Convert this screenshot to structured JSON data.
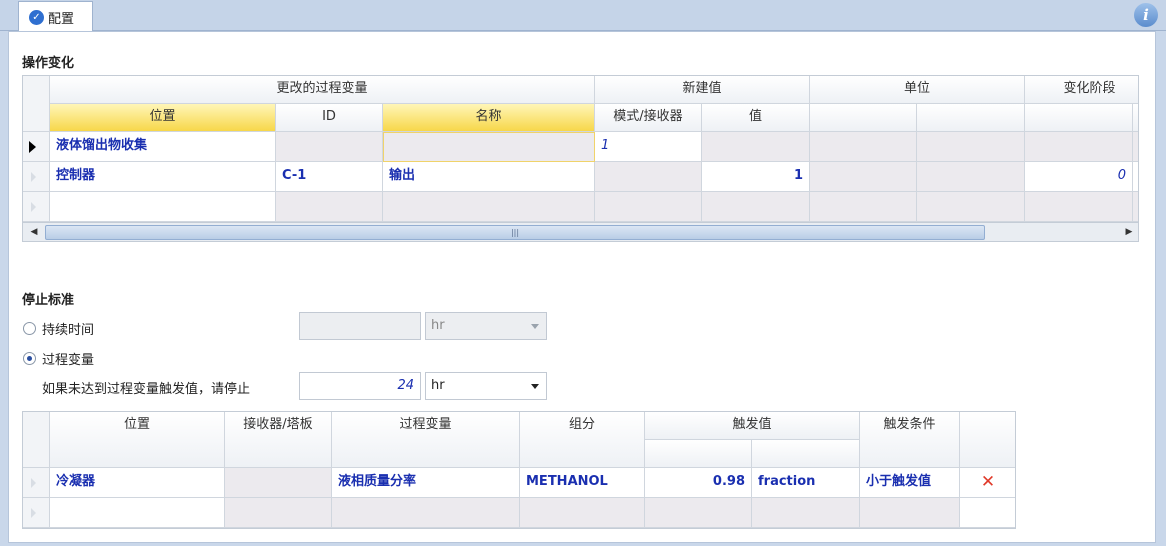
{
  "tab": {
    "label": "配置"
  },
  "sections": {
    "operation_change": "操作变化",
    "stop_criteria": "停止标准"
  },
  "grid1": {
    "group_headers": [
      "更改的过程变量",
      "新建值",
      "单位",
      "变化阶段"
    ],
    "sub_headers": [
      "位置",
      "ID",
      "名称",
      "模式/接收器",
      "值"
    ],
    "rows": [
      {
        "location": "液体馏出物收集",
        "id": "",
        "name": "",
        "mode": "1",
        "value": "",
        "stage": ""
      },
      {
        "location": "控制器",
        "id": "C-1",
        "name": "输出",
        "mode": "",
        "value": "1",
        "stage": "0"
      },
      {
        "location": "",
        "id": "",
        "name": "",
        "mode": "",
        "value": "",
        "stage": ""
      }
    ],
    "scroll_grip": "|||"
  },
  "stop": {
    "radio_duration": "持续时间",
    "radio_process_var": "过程变量",
    "duration_value": "",
    "duration_unit": "hr",
    "stop_prompt": "如果未达到过程变量触发值，请停止",
    "stop_value": "24",
    "stop_unit": "hr"
  },
  "grid2": {
    "headers": [
      "位置",
      "接收器/塔板",
      "过程变量",
      "组分",
      "触发值",
      "触发条件"
    ],
    "rows": [
      {
        "location": "冷凝器",
        "receiver": "",
        "variable": "液相质量分率",
        "component": "METHANOL",
        "trigger_value": "0.98",
        "trigger_unit": "fraction",
        "condition": "小于触发值",
        "delete": "✕"
      },
      {
        "location": "",
        "receiver": "",
        "variable": "",
        "component": "",
        "trigger_value": "",
        "trigger_unit": "",
        "condition": "",
        "delete": ""
      }
    ]
  },
  "colors": {
    "accent": "#1a2fb0",
    "header_yellow": "#f7d74a",
    "delete": "#e03a2a"
  }
}
